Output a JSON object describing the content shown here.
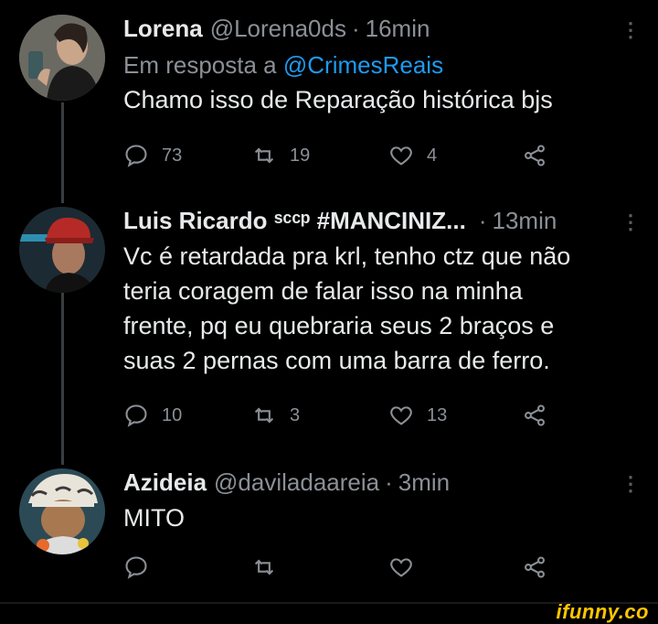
{
  "tweets": [
    {
      "name": "Lorena",
      "handle": "@Lorena0ds",
      "separator": "·",
      "time": "16min",
      "reply_prefix": "Em resposta a",
      "reply_mention": "@CrimesReais",
      "text": "Chamo isso de Reparação histórica bjs",
      "replies": "73",
      "retweets": "19",
      "likes": "4"
    },
    {
      "name": "Luis Ricardo ˢᶜᶜᵖ #MANCINIZ...",
      "separator": "·",
      "time": "13min",
      "text_lines": [
        "Vc é retardada pra krl, tenho ctz que não",
        "teria coragem de falar isso na minha",
        "frente, pq eu quebraria seus 2 braços e",
        "suas 2 pernas com uma barra de ferro."
      ],
      "replies": "10",
      "retweets": "3",
      "likes": "13"
    },
    {
      "name": "Azideia",
      "handle": "@daviladaareia",
      "separator": "·",
      "time": "3min",
      "text": "MITO"
    }
  ],
  "more_glyph": "⋮",
  "brand": "ifunny.co",
  "colors": {
    "background": "#000000",
    "text": "#e7e9ea",
    "muted": "#8b9096",
    "accent": "#1d9bf0",
    "brand": "#ffc600"
  }
}
